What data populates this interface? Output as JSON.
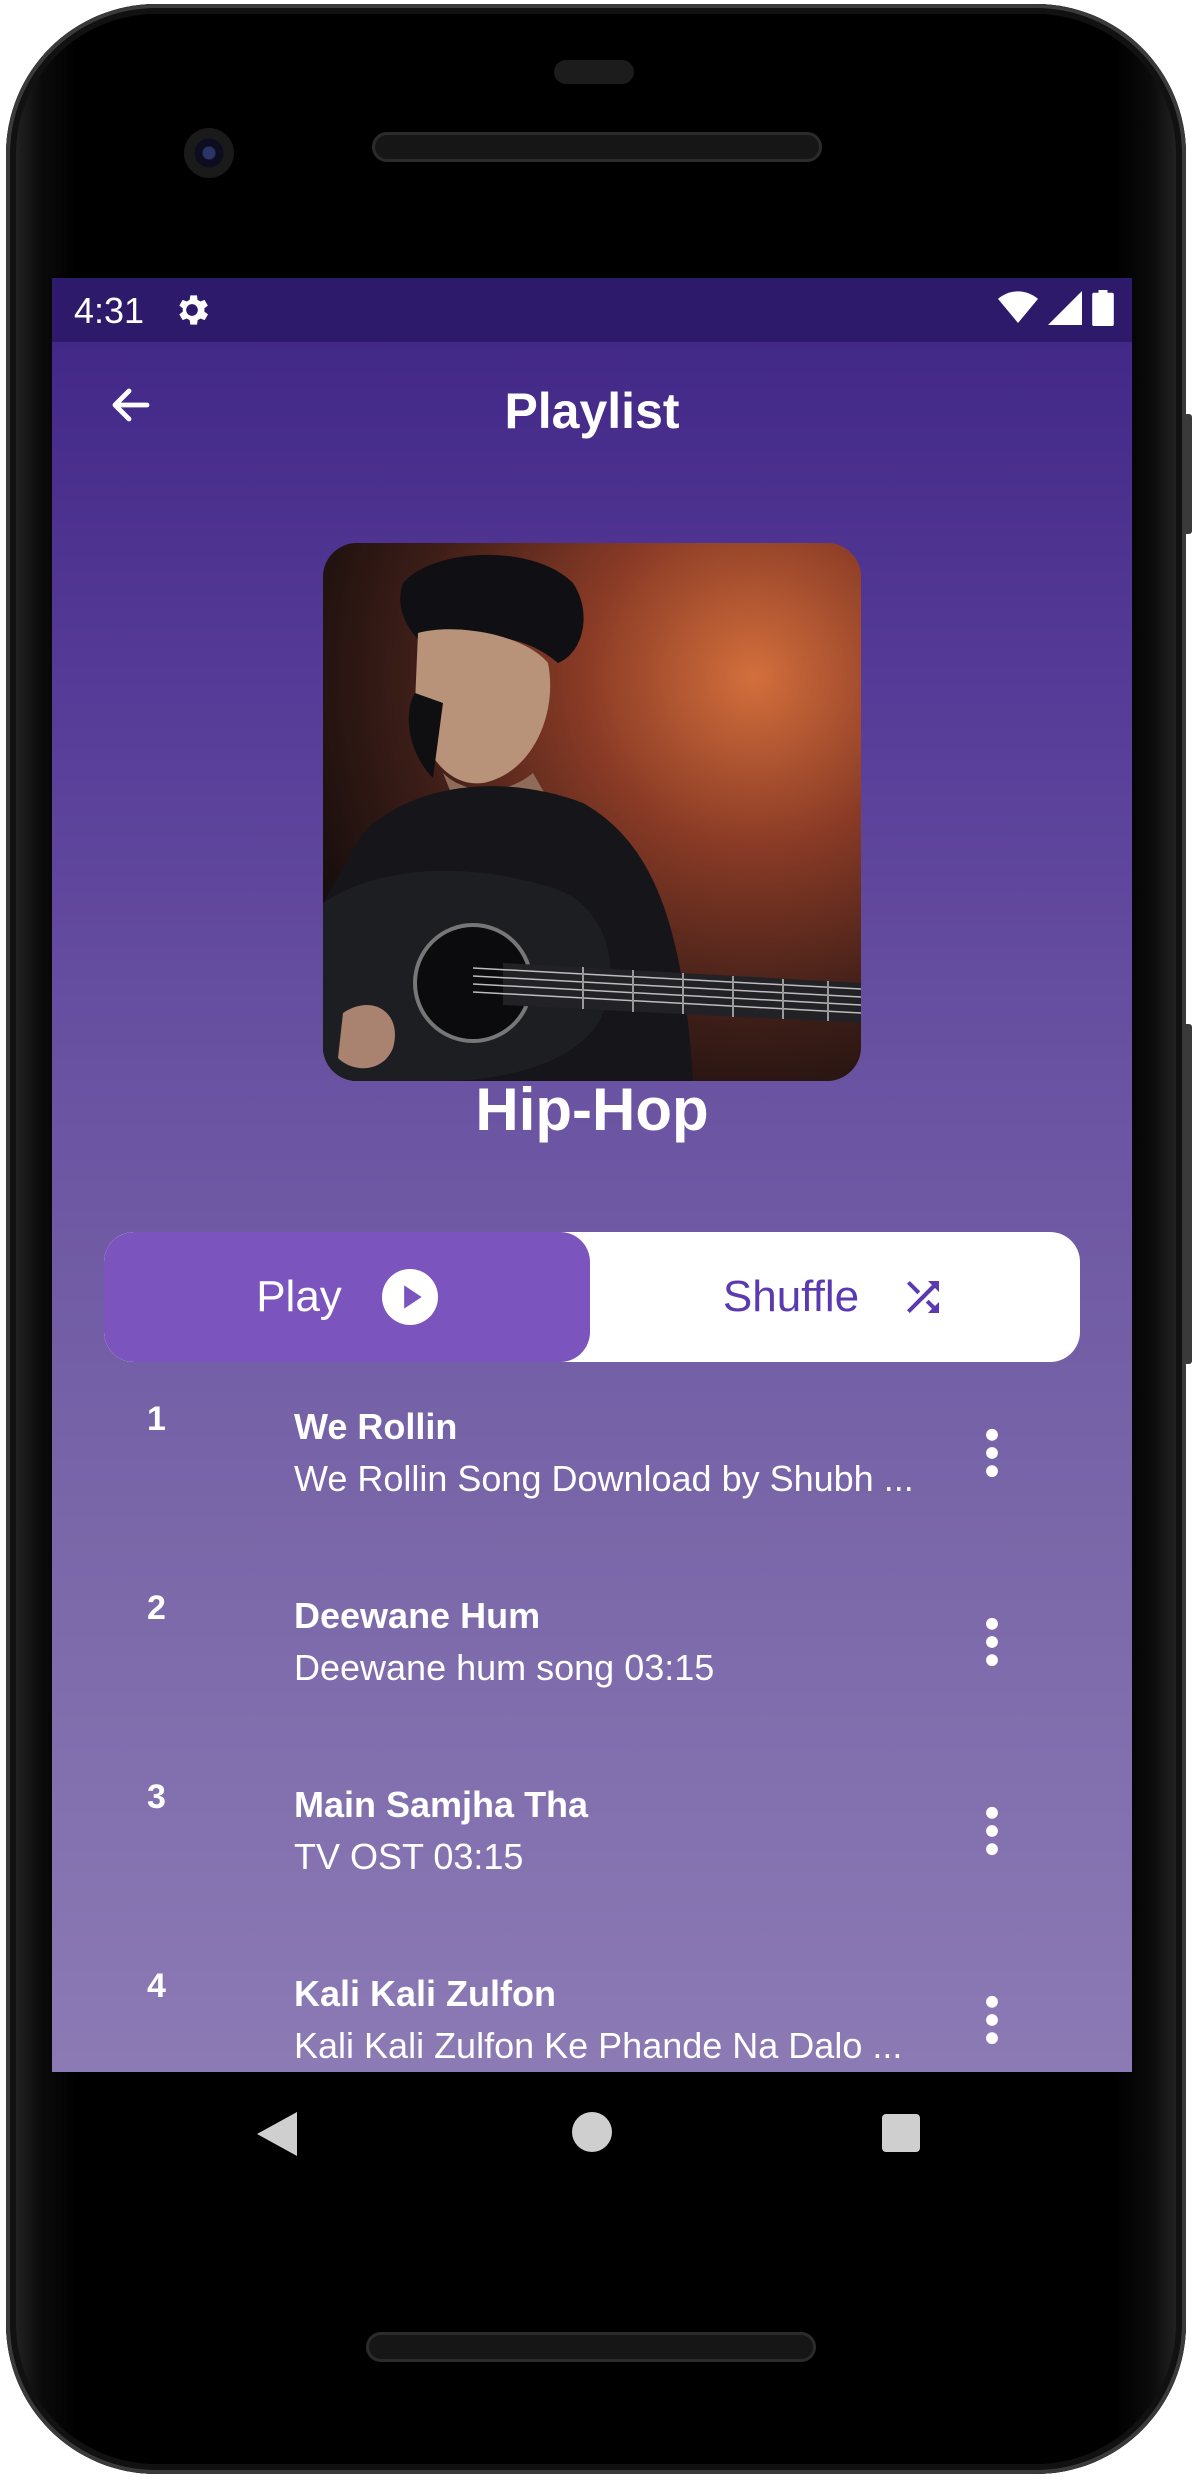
{
  "status_bar": {
    "time": "4:31"
  },
  "toolbar": {
    "title": "Playlist"
  },
  "playlist": {
    "name": "Hip-Hop"
  },
  "controls": {
    "play_label": "Play",
    "shuffle_label": "Shuffle"
  },
  "songs": [
    {
      "number": "1",
      "title": "We Rollin",
      "subtitle": "We Rollin Song Download by Shubh ..."
    },
    {
      "number": "2",
      "title": "Deewane Hum",
      "subtitle": "Deewane hum song 03:15"
    },
    {
      "number": "3",
      "title": "Main Samjha Tha",
      "subtitle": "TV OST 03:15"
    },
    {
      "number": "4",
      "title": "Kali Kali Zulfon",
      "subtitle": "Kali Kali Zulfon Ke Phande Na Dalo ..."
    }
  ],
  "colors": {
    "status_bar": "#2e1a6b",
    "header_gradient_top": "#3f2584",
    "list_gradient_bottom": "#8c7ab5",
    "play_button": "#7b55bd",
    "shuffle_text": "#5a3ab0"
  },
  "icons": {
    "back": "arrow-left-icon",
    "settings": "gear-icon",
    "wifi": "wifi-icon",
    "signal": "signal-icon",
    "battery": "battery-icon",
    "play": "play-circle-icon",
    "shuffle": "shuffle-icon",
    "more": "more-vertical-icon"
  }
}
